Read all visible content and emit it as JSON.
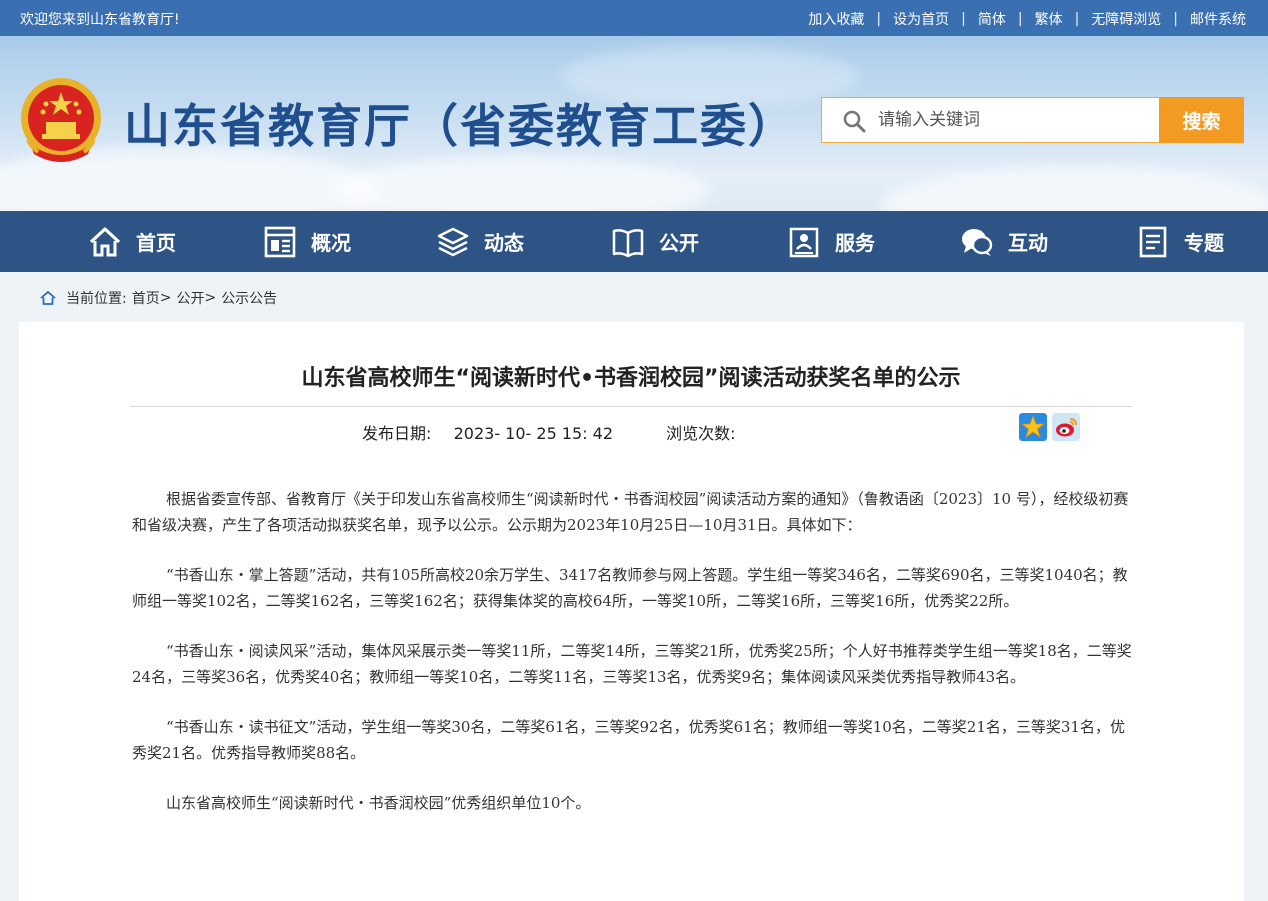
{
  "topbar": {
    "welcome": "欢迎您来到山东省教育厅!",
    "links": [
      "加入收藏",
      "设为首页",
      "简体",
      "繁体",
      "无障碍浏览",
      "邮件系统"
    ]
  },
  "header": {
    "title": "山东省教育厅（省委教育工委）",
    "search_placeholder": "请输入关键词",
    "search_button": "搜索"
  },
  "nav": {
    "items": [
      {
        "label": "首页",
        "icon": "home-icon"
      },
      {
        "label": "概况",
        "icon": "overview-icon"
      },
      {
        "label": "动态",
        "icon": "news-stack-icon"
      },
      {
        "label": "公开",
        "icon": "open-book-icon"
      },
      {
        "label": "服务",
        "icon": "service-icon"
      },
      {
        "label": "互动",
        "icon": "chat-icon"
      },
      {
        "label": "专题",
        "icon": "document-icon"
      }
    ]
  },
  "breadcrumb": {
    "prefix": "当前位置:",
    "items": [
      "首页",
      "公开",
      "公示公告"
    ],
    "sep": ">"
  },
  "article": {
    "title": "山东省高校师生“阅读新时代•书香润校园”阅读活动获奖名单的公示",
    "date_label": "发布日期:",
    "date": "2023- 10- 25 15: 42",
    "views_label": "浏览次数:",
    "paragraphs": [
      "根据省委宣传部、省教育厅《关于印发山东省高校师生“阅读新时代・书香润校园”阅读活动方案的通知》（鲁教语函〔2023〕10 号），经校级初赛和省级决赛，产生了各项活动拟获奖名单，现予以公示。公示期为2023年10月25日—10月31日。具体如下：",
      "“书香山东・掌上答题”活动，共有105所高校20余万学生、3417名教师参与网上答题。学生组一等奖346名，二等奖690名，三等奖1040名；教师组一等奖102名，二等奖162名，三等奖162名；获得集体奖的高校64所，一等奖10所，二等奖16所，三等奖16所，优秀奖22所。",
      "“书香山东・阅读风采”活动，集体风采展示类一等奖11所，二等奖14所，三等奖21所，优秀奖25所；个人好书推荐类学生组一等奖18名，二等奖24名，三等奖36名，优秀奖40名；教师组一等奖10名，二等奖11名，三等奖13名，优秀奖9名；集体阅读风采类优秀指导教师43名。",
      "“书香山东・读书征文”活动，学生组一等奖30名，二等奖61名，三等奖92名，优秀奖61名；教师组一等奖10名，二等奖21名，三等奖31名，优秀奖21名。优秀指导教师奖88名。",
      "山东省高校师生“阅读新时代・书香润校园”优秀组织单位10个。"
    ]
  },
  "colors": {
    "topbar": "#3a6fb2",
    "nav": "#2e5486",
    "title_blue": "#1f4f8f",
    "search_orange": "#f39a23"
  }
}
